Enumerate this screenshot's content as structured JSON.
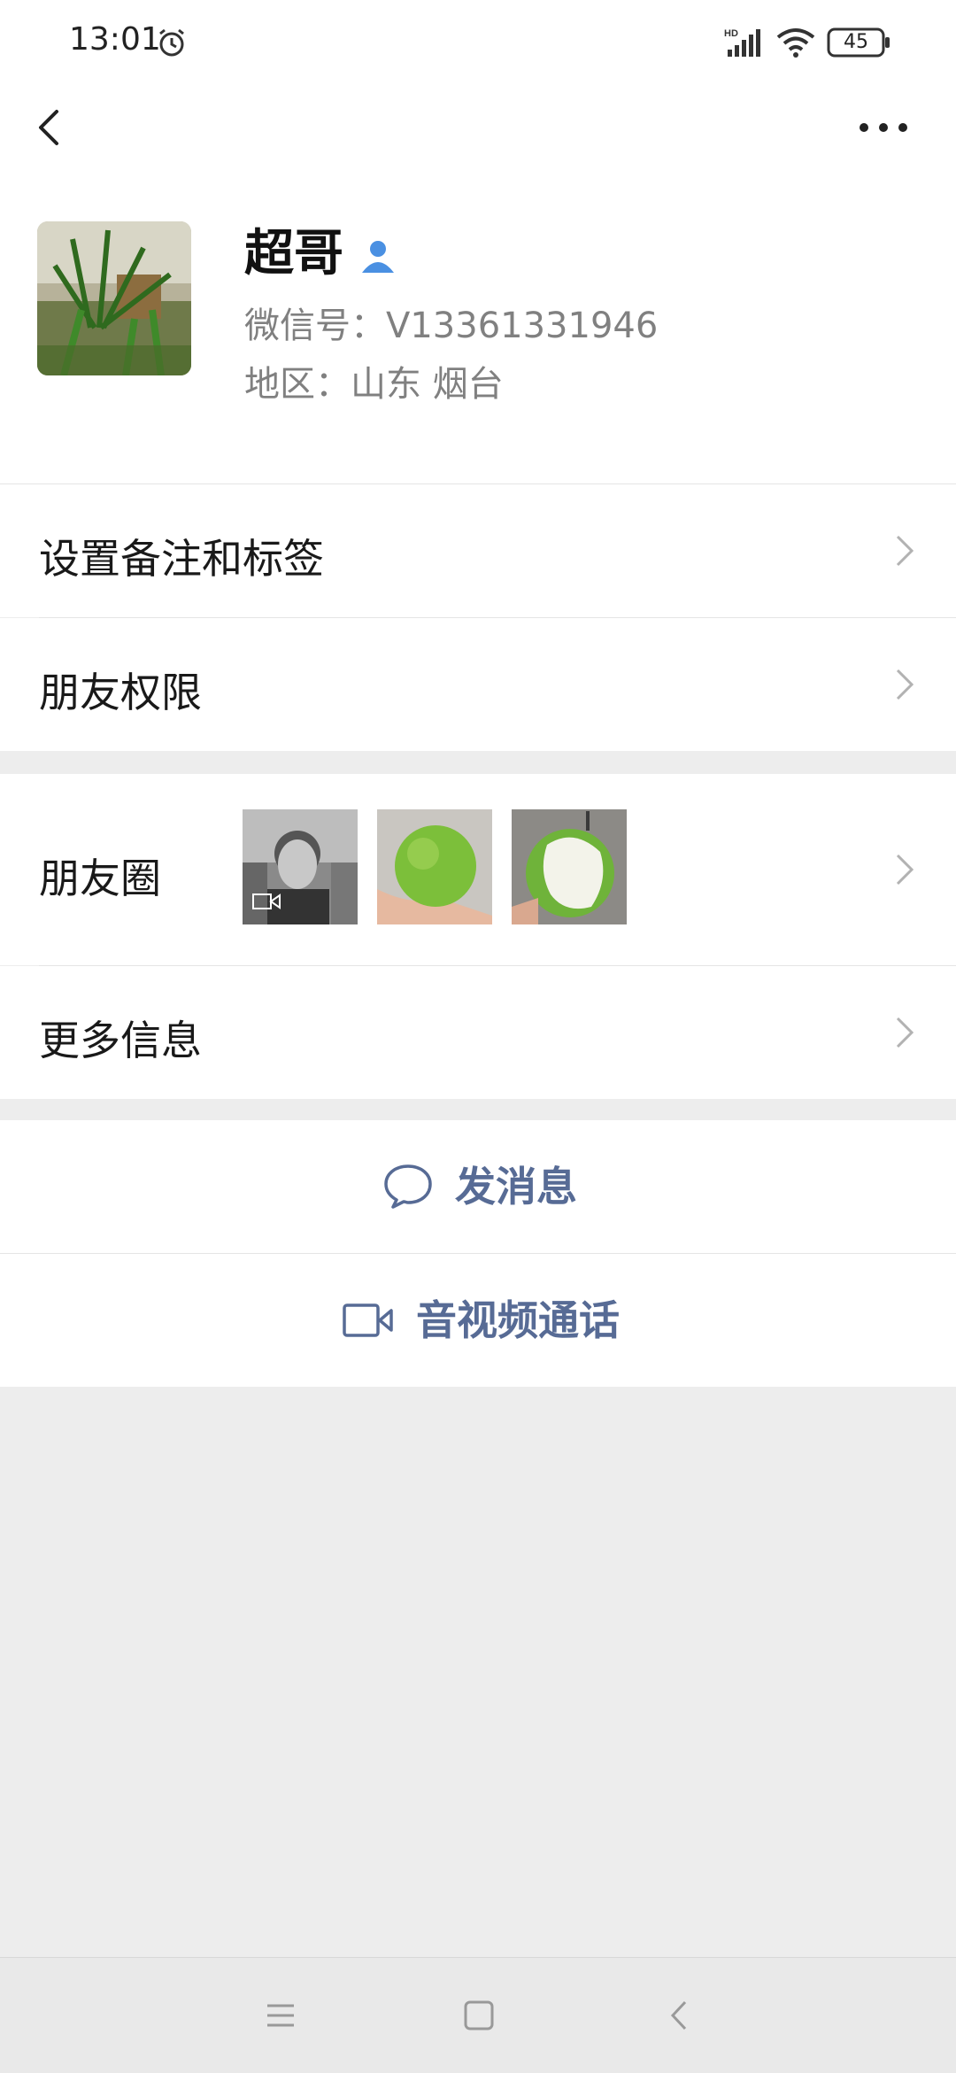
{
  "status_bar": {
    "time": "13:01",
    "battery": "45",
    "icons": [
      "alarm-icon",
      "hd-signal-icon",
      "wifi-icon",
      "battery-icon"
    ]
  },
  "nav": {
    "back_icon": "chevron-left-icon",
    "more_icon": "more-dots-icon"
  },
  "profile": {
    "name": "超哥",
    "badge_icon": "person-badge-icon",
    "wechat_id": "微信号：V13361331946",
    "region": "地区：山东  烟台"
  },
  "rows": {
    "remarks_tags": "设置备注和标签",
    "friend_permissions": "朋友权限",
    "moments": "朋友圈",
    "more_info": "更多信息"
  },
  "actions": {
    "send_message": "发消息",
    "video_call": "音视频通话"
  },
  "colors": {
    "link_blue": "#576b95",
    "background": "#ededed",
    "badge_blue": "#4a90e2"
  },
  "system_nav": [
    "menu-icon",
    "home-icon",
    "back-icon"
  ]
}
